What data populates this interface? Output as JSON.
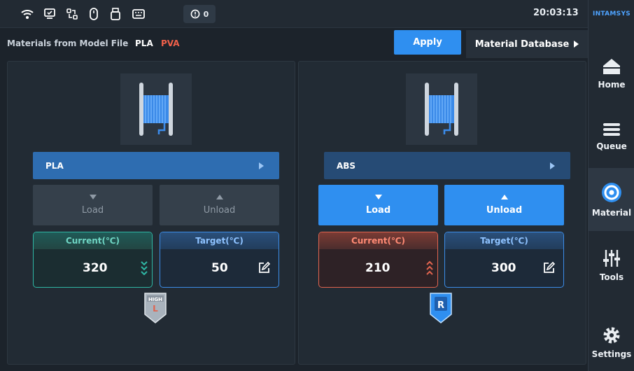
{
  "statusbar": {
    "alert_count": "0",
    "clock": "20:03:13"
  },
  "sidebar": {
    "brand": "INTAMSYS",
    "items": [
      {
        "label": "Home",
        "icon": "home-icon"
      },
      {
        "label": "Queue",
        "icon": "queue-icon"
      },
      {
        "label": "Material",
        "icon": "material-icon"
      },
      {
        "label": "Tools",
        "icon": "tools-icon"
      },
      {
        "label": "Settings",
        "icon": "settings-icon"
      }
    ],
    "active": "Material"
  },
  "header": {
    "materials_label": "Materials from Model File",
    "model_materials": [
      "PLA",
      "PVA"
    ],
    "apply_label": "Apply",
    "database_label": "Material Database"
  },
  "left_extruder": {
    "material": "PLA",
    "load_label": "Load",
    "unload_label": "Unload",
    "current_label": "Current(℃)",
    "current_value": "320",
    "target_label": "Target(℃)",
    "target_value": "50",
    "badge_top": "HIGH",
    "badge_letter": "L",
    "trend": "cooling"
  },
  "right_extruder": {
    "material": "ABS",
    "load_label": "Load",
    "unload_label": "Unload",
    "current_label": "Current(℃)",
    "current_value": "210",
    "target_label": "Target(℃)",
    "target_value": "300",
    "badge_letter": "R",
    "trend": "heating"
  },
  "colors": {
    "accent_blue": "#2f8ff0",
    "pva_red": "#f0604a",
    "cool_teal": "#2fb7a4",
    "heat_red": "#e0644f"
  }
}
